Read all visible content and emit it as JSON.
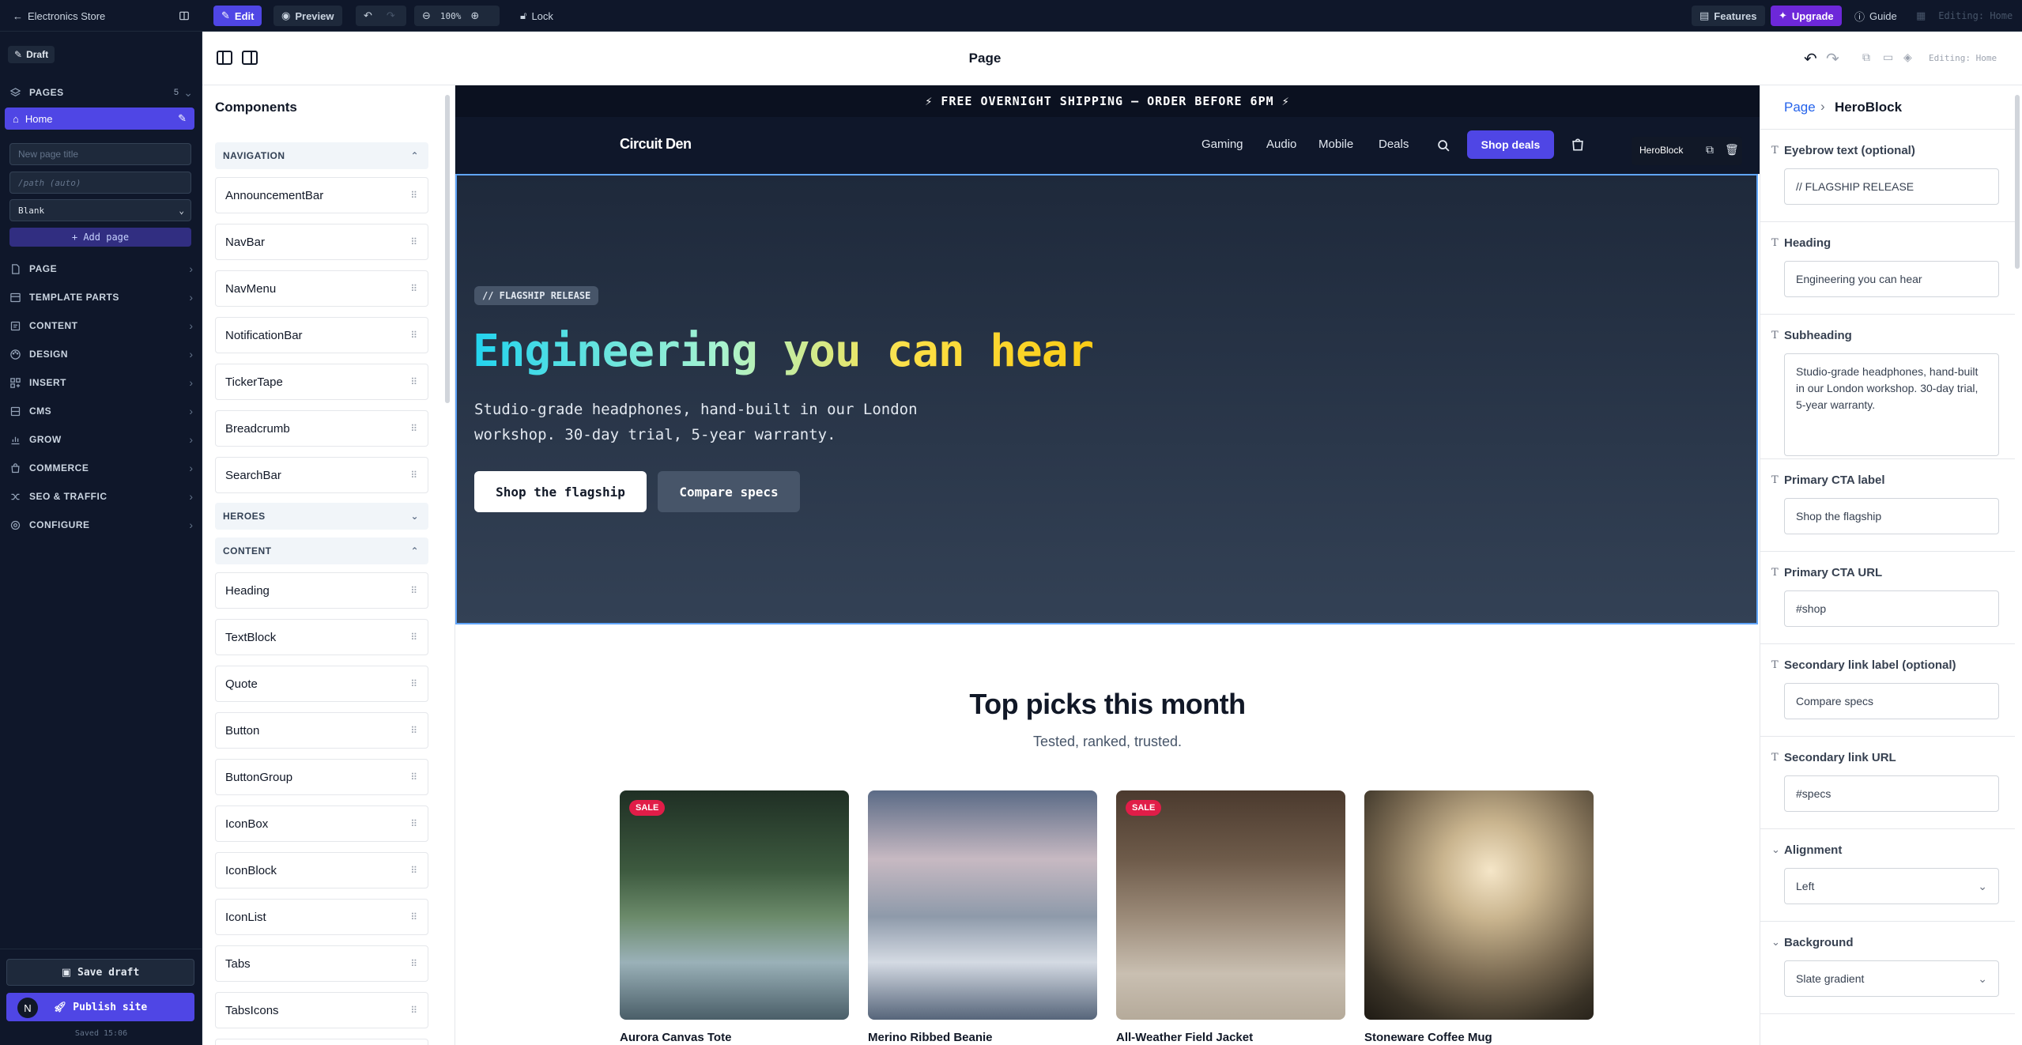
{
  "topbar": {
    "store_name": "Electronics Store",
    "edit": "Edit",
    "preview": "Preview",
    "zoom": "100%",
    "lock": "Lock",
    "features": "Features",
    "upgrade": "Upgrade",
    "guide": "Guide",
    "editing": "Editing: Home"
  },
  "sidebar": {
    "draft": "Draft",
    "pages_label": "PAGES",
    "pages_count": "5",
    "home": "Home",
    "new_title_placeholder": "New page title",
    "path_placeholder": "/path (auto)",
    "template": "Blank",
    "add_page": "+ Add page",
    "sections": [
      "PAGE",
      "TEMPLATE PARTS",
      "CONTENT",
      "DESIGN",
      "INSERT",
      "CMS",
      "GROW",
      "COMMERCE",
      "SEO & TRAFFIC",
      "CONFIGURE"
    ],
    "save_draft": "Save draft",
    "publish": "Publish site",
    "saved": "Saved 15:06",
    "avatar": "N"
  },
  "canvas": {
    "title": "Page",
    "editing": "Editing: Home"
  },
  "components": {
    "title": "Components",
    "nav_section": "NAVIGATION",
    "nav_items": [
      "AnnouncementBar",
      "NavBar",
      "NavMenu",
      "NotificationBar",
      "TickerTape",
      "Breadcrumb",
      "SearchBar"
    ],
    "heroes_section": "HEROES",
    "content_section": "CONTENT",
    "content_items": [
      "Heading",
      "TextBlock",
      "Quote",
      "Button",
      "ButtonGroup",
      "IconBox",
      "IconBlock",
      "IconList",
      "Tabs",
      "TabsIcons"
    ]
  },
  "site": {
    "announcement": "⚡ FREE OVERNIGHT SHIPPING — ORDER BEFORE 6PM ⚡",
    "brand": "Circuit Den",
    "nav": [
      "Gaming",
      "Audio",
      "Mobile",
      "Deals"
    ],
    "shop_deals": "Shop deals",
    "block_tag": "HeroBlock",
    "hero": {
      "eyebrow": "// FLAGSHIP RELEASE",
      "heading": "Engineering you can hear",
      "sub_line1": "Studio-grade headphones, hand-built in our London",
      "sub_line2": "workshop. 30-day trial, 5-year warranty.",
      "cta_primary": "Shop the flagship",
      "cta_secondary": "Compare specs"
    },
    "picks": {
      "title": "Top picks this month",
      "subtitle": "Tested, ranked, trusted.",
      "sale_label": "SALE",
      "products": [
        "Aurora Canvas Tote",
        "Merino Ribbed Beanie",
        "All-Weather Field Jacket",
        "Stoneware Coffee Mug"
      ]
    }
  },
  "inspector": {
    "crumb_page": "Page",
    "crumb_block": "HeroBlock",
    "fields": [
      {
        "label": "Eyebrow text (optional)",
        "value": "// FLAGSHIP RELEASE"
      },
      {
        "label": "Heading",
        "value": "Engineering you can hear"
      },
      {
        "label": "Subheading",
        "value": "Studio-grade headphones, hand-built in our London workshop. 30-day trial, 5-year warranty."
      },
      {
        "label": "Primary CTA label",
        "value": "Shop the flagship"
      },
      {
        "label": "Primary CTA URL",
        "value": "#shop"
      },
      {
        "label": "Secondary link label (optional)",
        "value": "Compare specs"
      },
      {
        "label": "Secondary link URL",
        "value": "#specs"
      },
      {
        "label": "Alignment",
        "value": "Left"
      },
      {
        "label": "Background",
        "value": "Slate gradient"
      }
    ]
  },
  "colors": {
    "accent": "#4f46e5",
    "upgrade": "#6d28d9",
    "sale": "#e11d48",
    "shop_btn": "#4f46e5"
  }
}
